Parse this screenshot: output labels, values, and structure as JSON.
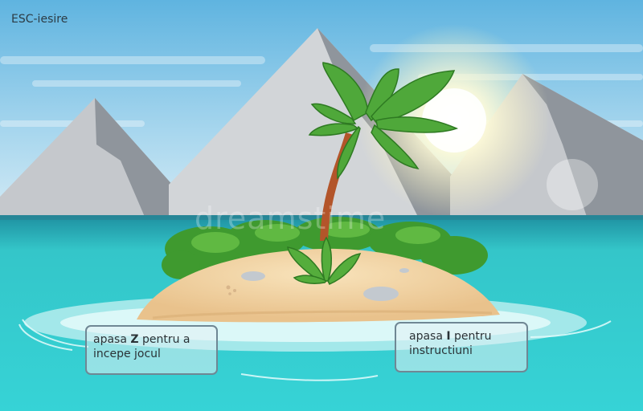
{
  "game": {
    "exit_hint": "ESC-iesire",
    "watermark": "dreamstime",
    "buttons": {
      "start": {
        "pre": "apasa ",
        "key": "Z",
        "post": " pentru a",
        "line2": "incepe jocul"
      },
      "help": {
        "pre": "apasa ",
        "key": "I",
        "post": " pentru",
        "line2": "instructiuni"
      }
    }
  },
  "colors": {
    "sky_top": "#5fb4e0",
    "sky_bottom": "#d6ecf6",
    "sea": "#34cfd1",
    "sand": "#f1d6a7",
    "palm_leaf": "#4fa83a",
    "sun": "#fff7c8"
  }
}
